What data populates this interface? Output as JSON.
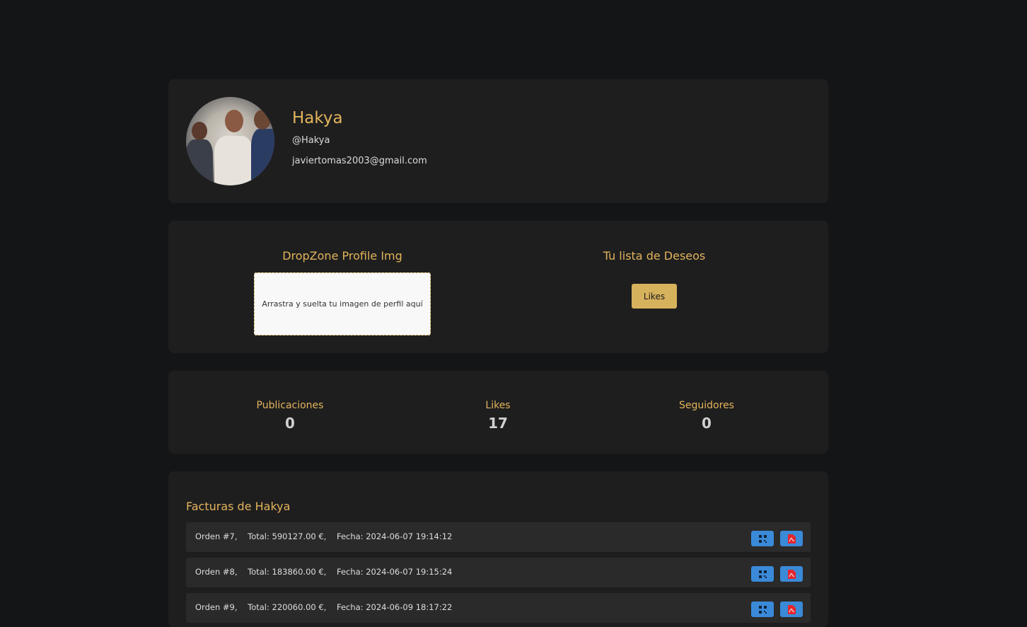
{
  "profile": {
    "name": "Hakya",
    "username": "@Hakya",
    "email": "javiertomas2003@gmail.com"
  },
  "dropzone": {
    "title": "DropZone Profile Img",
    "hint": "Arrastra y suelta tu imagen de perfil aquí"
  },
  "wishlist": {
    "title": "Tu lista de Deseos",
    "button_label": "Likes"
  },
  "stats": [
    {
      "label": "Publicaciones",
      "value": "0"
    },
    {
      "label": "Likes",
      "value": "17"
    },
    {
      "label": "Seguidores",
      "value": "0"
    }
  ],
  "facturas": {
    "title": "Facturas de Hakya",
    "rows": [
      {
        "text": "Orden #7,    Total: 590127.00 €,    Fecha: 2024-06-07 19:14:12"
      },
      {
        "text": "Orden #8,    Total: 183860.00 €,    Fecha: 2024-06-07 19:15:24"
      },
      {
        "text": "Orden #9,    Total: 220060.00 €,    Fecha: 2024-06-09 18:17:22"
      }
    ],
    "icons": {
      "qr": "qr-code-icon",
      "pdf": "pdf-icon"
    }
  },
  "colors": {
    "background": "#141517",
    "card": "#1e1e1f",
    "accent": "#e3b45b",
    "button_blue": "#3a8ad8",
    "likes_button": "#d7b25c"
  }
}
